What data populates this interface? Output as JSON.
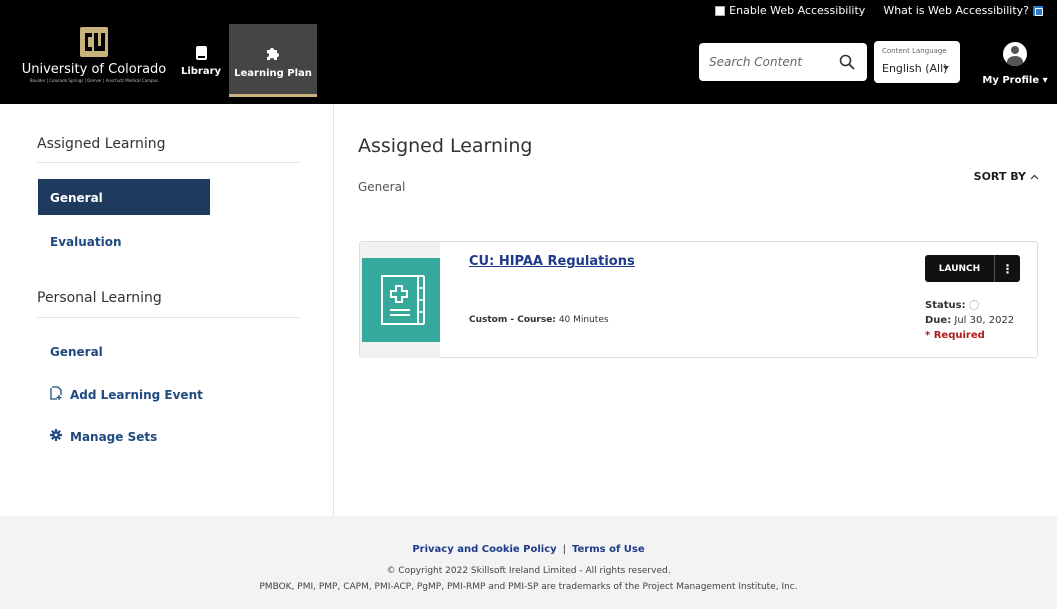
{
  "header": {
    "accessibility_toggle_label": "Enable Web Accessibility",
    "accessibility_help_link": "What is Web Accessibility?",
    "logo": {
      "name": "University of Colorado",
      "campuses": "Boulder | Colorado Springs | Denver | Anschutz Medical Campus",
      "gold": "#c8b47a"
    },
    "nav": [
      {
        "label": "Library",
        "icon": "book-icon"
      },
      {
        "label": "Learning Plan",
        "icon": "puzzle-icon",
        "active": true
      }
    ],
    "search": {
      "placeholder": "Search Content",
      "icon": "search-icon"
    },
    "language": {
      "label": "Content Language",
      "value": "English (All)"
    },
    "profile": {
      "label": "My Profile ▾"
    }
  },
  "sidebar": {
    "assigned_heading": "Assigned Learning",
    "assigned_items": [
      {
        "label": "General",
        "active": true
      },
      {
        "label": "Evaluation"
      }
    ],
    "personal_heading": "Personal Learning",
    "personal_items": [
      {
        "label": "General"
      },
      {
        "label": "Add Learning Event",
        "icon": "add-event-icon"
      },
      {
        "label": "Manage Sets",
        "icon": "gear-icon"
      }
    ],
    "active_color": "#1e3a5c"
  },
  "main": {
    "title": "Assigned Learning",
    "subtitle": "General",
    "sort_label": "SORT BY",
    "card": {
      "title": "CU: HIPAA Regulations",
      "type_label": "Custom - Course:",
      "duration": "40 Minutes",
      "launch_label": "LAUNCH",
      "more_label": "⋮",
      "status_label": "Status:",
      "due_label": "Due:",
      "due_value": "Jul 30, 2022",
      "required_label": "* Required",
      "thumb_color": "#35a99c"
    }
  },
  "footer": {
    "privacy_link": "Privacy and Cookie Policy",
    "separator": "|",
    "terms_link": "Terms of Use",
    "copyright": "© Copyright 2022 Skillsoft Ireland Limited - All rights reserved.",
    "trademark": "PMBOK, PMI, PMP, CAPM, PMI-ACP, PgMP, PMI-RMP and PMI-SP are trademarks of the Project Management Institute, Inc."
  }
}
